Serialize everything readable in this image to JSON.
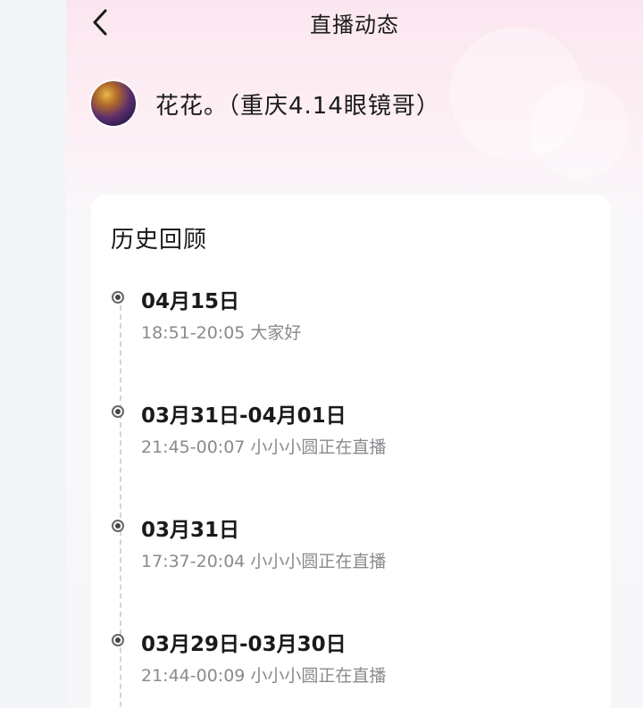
{
  "header": {
    "title": "直播动态",
    "back_icon": "chevron-left-icon"
  },
  "profile": {
    "name": "花花。（重庆4.14眼镜哥）"
  },
  "history": {
    "title": "历史回顾",
    "items": [
      {
        "date": "04月15日",
        "detail": "18:51-20:05 大家好"
      },
      {
        "date": "03月31日-04月01日",
        "detail": "21:45-00:07 小小小圆正在直播"
      },
      {
        "date": "03月31日",
        "detail": "17:37-20:04 小小小圆正在直播"
      },
      {
        "date": "03月29日-03月30日",
        "detail": "21:44-00:09 小小小圆正在直播"
      }
    ]
  },
  "colors": {
    "header_gradient_top": "#fbe6ef",
    "card_background": "#ffffff",
    "secondary_text": "#8a8a8f",
    "primary_text": "#1a1a1a"
  }
}
